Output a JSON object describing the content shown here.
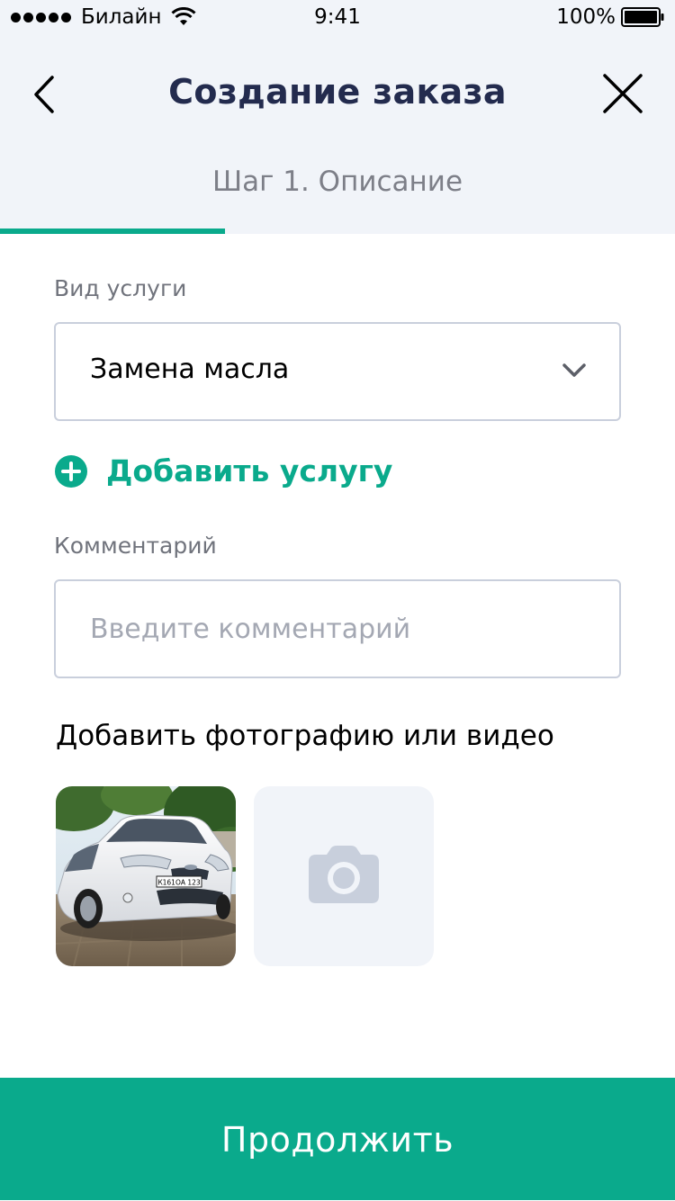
{
  "status_bar": {
    "carrier": "Билайн",
    "time": "9:41",
    "battery": "100%",
    "signal_icon": "signal-dots-icon",
    "wifi_icon": "wifi-icon",
    "battery_icon": "battery-icon"
  },
  "nav": {
    "title": "Создание заказа",
    "back_icon": "chevron-left-icon",
    "close_icon": "close-icon"
  },
  "step": {
    "label": "Шаг 1. Описание",
    "progress": 0.333
  },
  "form": {
    "service_label": "Вид услуги",
    "service_value": "Замена масла",
    "add_service_label": "Добавить услугу",
    "comment_label": "Комментарий",
    "comment_value": "",
    "comment_placeholder": "Введите комментарий",
    "media_heading": "Добавить фотографию или видео",
    "plate_text": "К161ОА 123"
  },
  "footer": {
    "continue_label": "Продолжить"
  },
  "colors": {
    "accent": "#0aaa8c",
    "title": "#232b4e",
    "header_bg": "#f1f4f9",
    "border": "#c9cfdc",
    "muted": "#70737c",
    "placeholder": "#a4a8b3",
    "camera": "#c8cfdc"
  }
}
